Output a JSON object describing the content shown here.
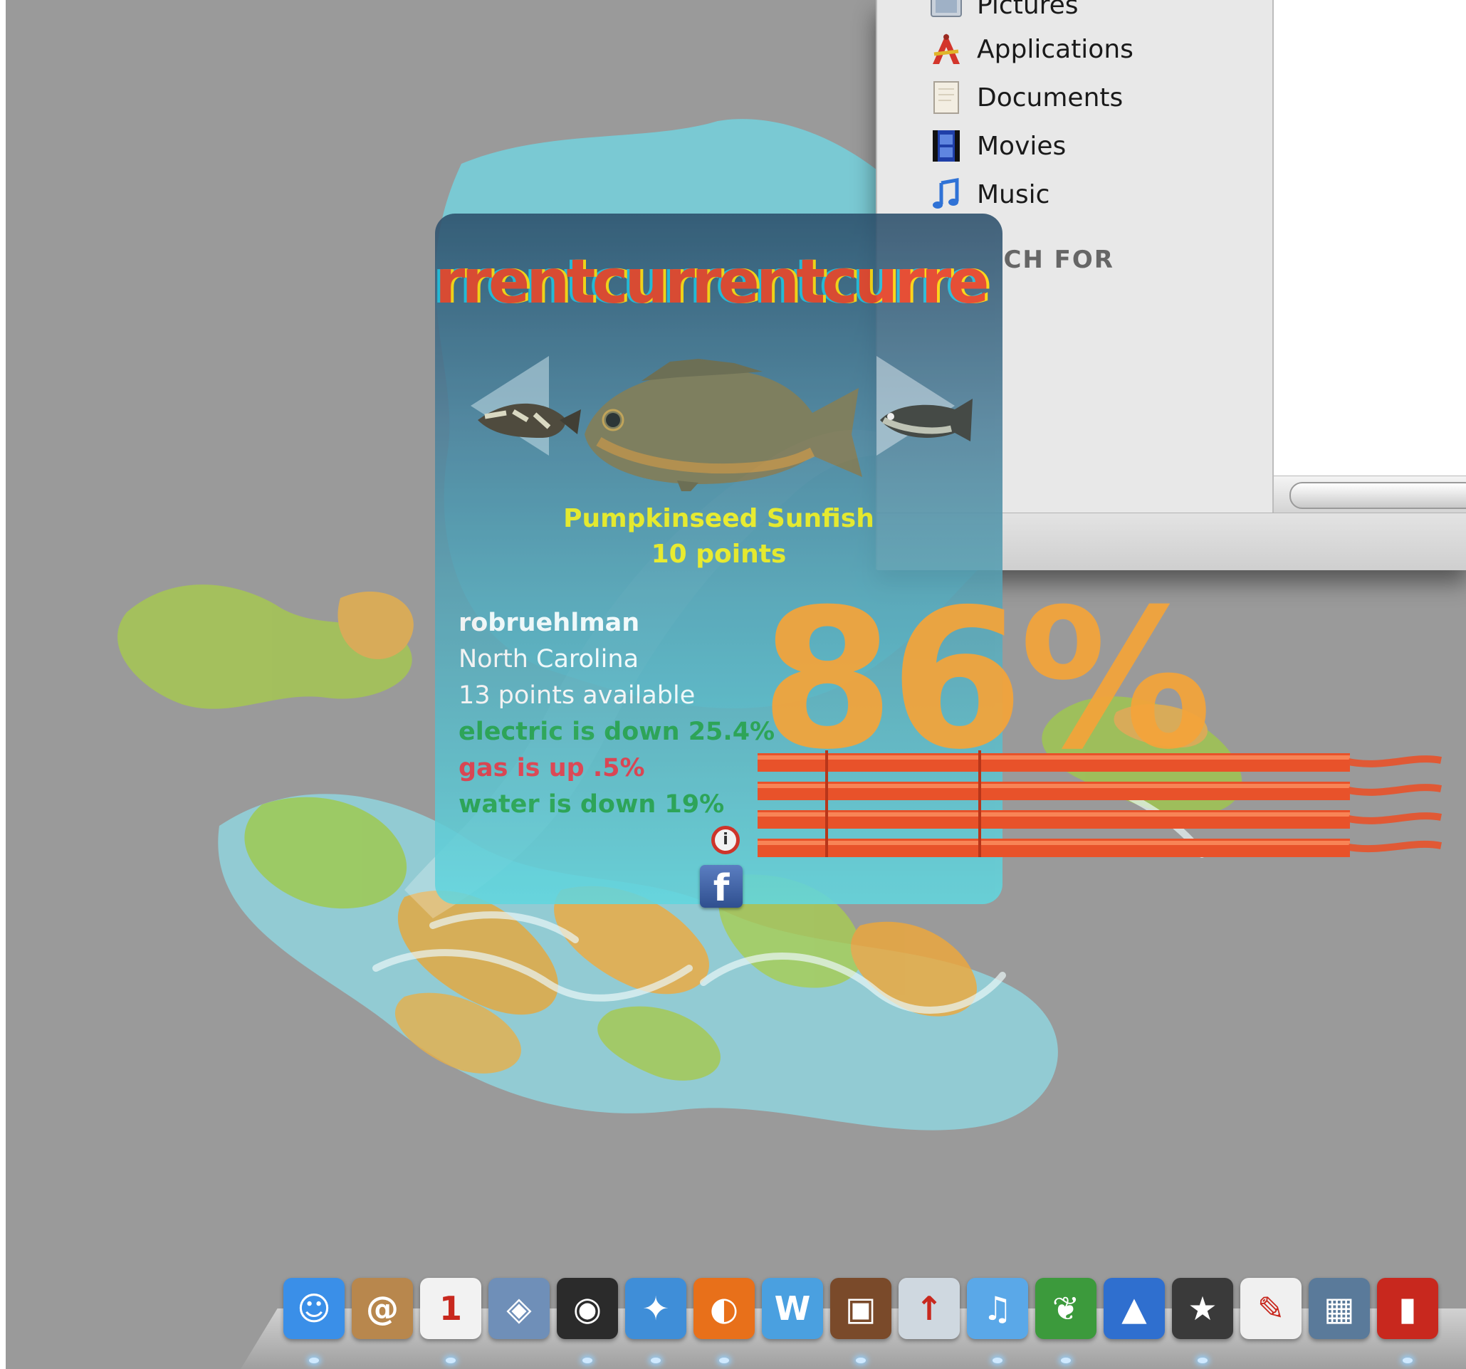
{
  "finder": {
    "sidebar_items": [
      {
        "label": "Pictures",
        "icon": "pictures-folder-icon"
      },
      {
        "label": "Applications",
        "icon": "applications-folder-icon"
      },
      {
        "label": "Documents",
        "icon": "documents-folder-icon"
      },
      {
        "label": "Movies",
        "icon": "movies-folder-icon"
      },
      {
        "label": "Music",
        "icon": "music-folder-icon"
      }
    ],
    "search_heading": "CH FOR"
  },
  "widget": {
    "ribbon_text": "rrentcurrentcurre",
    "fish": {
      "name": "Pumpkinseed Sunfish",
      "points": "10 points"
    },
    "user": {
      "username": "robruehlman",
      "location": "North Carolina",
      "points_available": "13 points available"
    },
    "stats": {
      "electric": "electric is down 25.4%",
      "gas": "gas is up .5%",
      "water": "water is down 19%"
    },
    "info_label": "i",
    "percent": "86%",
    "bar_fill_ratio": 0.86,
    "facebook_label": "f"
  },
  "colors": {
    "desktop": "#9a9a9a",
    "fish_text": "#f3ee1a",
    "stat_good": "#1fa64f",
    "stat_bad": "#e23b4a",
    "user_text": "#ffffff",
    "percent": "#f4a43a",
    "bars": "#e8522a"
  },
  "dock": {
    "items": [
      {
        "name": "finder",
        "icon": "finder-icon",
        "color": "#3a8fe8",
        "glyph": "☺"
      },
      {
        "name": "address-book",
        "icon": "address-book-icon",
        "color": "#b8874d",
        "glyph": "@"
      },
      {
        "name": "ical",
        "icon": "calendar-icon",
        "color": "#f2f2f2",
        "glyph": "1"
      },
      {
        "name": "preview",
        "icon": "preview-icon",
        "color": "#6f8fb8",
        "glyph": "◈"
      },
      {
        "name": "dashboard",
        "icon": "dashboard-icon",
        "color": "#2b2b2b",
        "glyph": "◉"
      },
      {
        "name": "safari",
        "icon": "safari-icon",
        "color": "#3f8ed8",
        "glyph": "✦"
      },
      {
        "name": "firefox",
        "icon": "firefox-icon",
        "color": "#e8701a",
        "glyph": "◐"
      },
      {
        "name": "word",
        "icon": "word-icon",
        "color": "#4aa0e0",
        "glyph": "W"
      },
      {
        "name": "iphoto",
        "icon": "iphoto-icon",
        "color": "#7a4a2a",
        "glyph": "▣"
      },
      {
        "name": "flickr",
        "icon": "flickr-uploader-icon",
        "color": "#cfd8e0",
        "glyph": "↑"
      },
      {
        "name": "itunes",
        "icon": "itunes-icon",
        "color": "#5aa8e8",
        "glyph": "♫"
      },
      {
        "name": "evernote",
        "icon": "evernote-icon",
        "color": "#3c9a3c",
        "glyph": "❦"
      },
      {
        "name": "skype",
        "icon": "bottle-icon",
        "color": "#2f6fcf",
        "glyph": "▲"
      },
      {
        "name": "imovie",
        "icon": "imovie-icon",
        "color": "#3a3a3a",
        "glyph": "★"
      },
      {
        "name": "textedit",
        "icon": "textedit-icon",
        "color": "#f0f0f0",
        "glyph": "✎"
      },
      {
        "name": "spaces",
        "icon": "spaces-icon",
        "color": "#5a7a9a",
        "glyph": "▦"
      },
      {
        "name": "lexar",
        "icon": "red-drive-icon",
        "color": "#c8281e",
        "glyph": "▮"
      }
    ],
    "running_indices": [
      0,
      2,
      4,
      5,
      6,
      8,
      10,
      11,
      13,
      16
    ]
  }
}
